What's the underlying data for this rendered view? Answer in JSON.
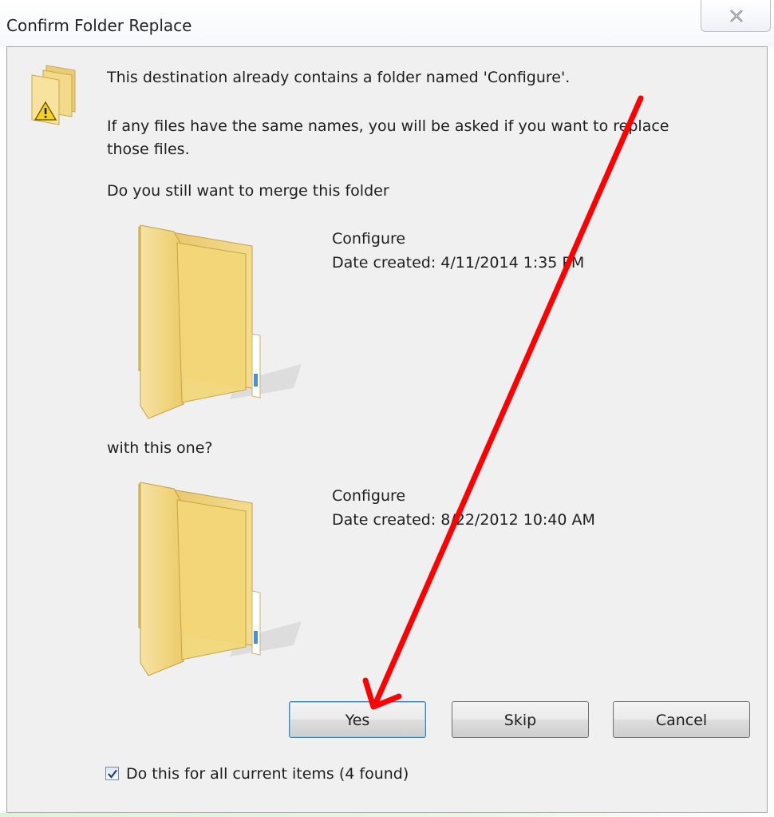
{
  "window": {
    "title": "Confirm Folder Replace"
  },
  "message": {
    "line1": "This destination already contains a folder named 'Configure'.",
    "line2a": "If any files have the same names, you will be asked if you want to replace",
    "line2b": "those files.",
    "question": "Do you still want to merge this folder",
    "with_this_one": "with this one?"
  },
  "destination_folder": {
    "name": "Configure",
    "date": "Date created: 4/11/2014 1:35 PM"
  },
  "source_folder": {
    "name": "Configure",
    "date": "Date created: 8/22/2012 10:40 AM"
  },
  "buttons": {
    "yes": "Yes",
    "skip": "Skip",
    "cancel": "Cancel"
  },
  "apply_all": {
    "checked": true,
    "label": "Do this for all current items (4 found)"
  },
  "colors": {
    "annotation_arrow": "#ff0000",
    "folder": "#f3d77e",
    "panel": "#f0f0f0"
  },
  "icons": [
    "folder-warning-icon",
    "folder-icon",
    "close-icon",
    "checkmark-icon"
  ]
}
